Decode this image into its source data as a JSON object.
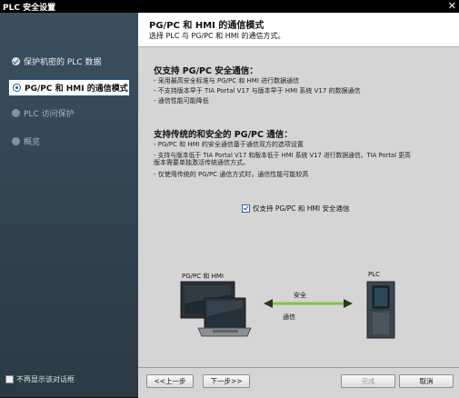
{
  "window": {
    "title": "PLC 安全设置",
    "close_glyph": "✕"
  },
  "sidebar": {
    "items": [
      {
        "label": "保护机密的 PLC 数据",
        "state": "done"
      },
      {
        "label": "PG/PC 和 HMI 的通信模式",
        "state": "active"
      },
      {
        "label": "PLC 访问保护",
        "state": "disabled"
      },
      {
        "label": "概览",
        "state": "disabled"
      }
    ],
    "dont_show_label": "不再显示该对话框"
  },
  "header": {
    "title": "PG/PC 和 HMI 的通信模式",
    "subtitle": "选择 PLC 与 PG/PC 和 HMI 的通信方式。"
  },
  "section1": {
    "title": "仅支持 PG/PC 安全通信：",
    "lines": [
      "- 采用最高安全标准与 PG/PC 和 HMI 进行数据通信",
      "- 不支持版本早于 TIA Portal V17 与版本早于 HMI 系统 V17 的数据通信",
      "- 通信性能可能降低"
    ]
  },
  "section2": {
    "title": "支持传统的和安全的 PG/PC 通信：",
    "lines": [
      "- PG/PC 和 HMI 的安全通信基于通信双方的选项设置",
      "- 支持与版本低于 TIA Portal V17 和版本低于 HMI 系统 V17 进行数据通信。TIA Portal 更高",
      "  版本需要单独激活传统通信方式。",
      "- 仅使用传统的 PG/PC 通信方式时，通信性能可能较高"
    ]
  },
  "checkbox": {
    "label": "仅支持 PG/PC 和 HMI 安全通信",
    "checked": true
  },
  "diagram": {
    "left_label": "PG/PC 和 HMI",
    "right_label": "PLC",
    "arrow_top_label": "安全",
    "arrow_bottom_label": "通信",
    "arrow_color": "#7fc83a"
  },
  "footer": {
    "back": "<<上一步",
    "next": "下一步>>",
    "finish": "完成",
    "cancel": "取消"
  }
}
